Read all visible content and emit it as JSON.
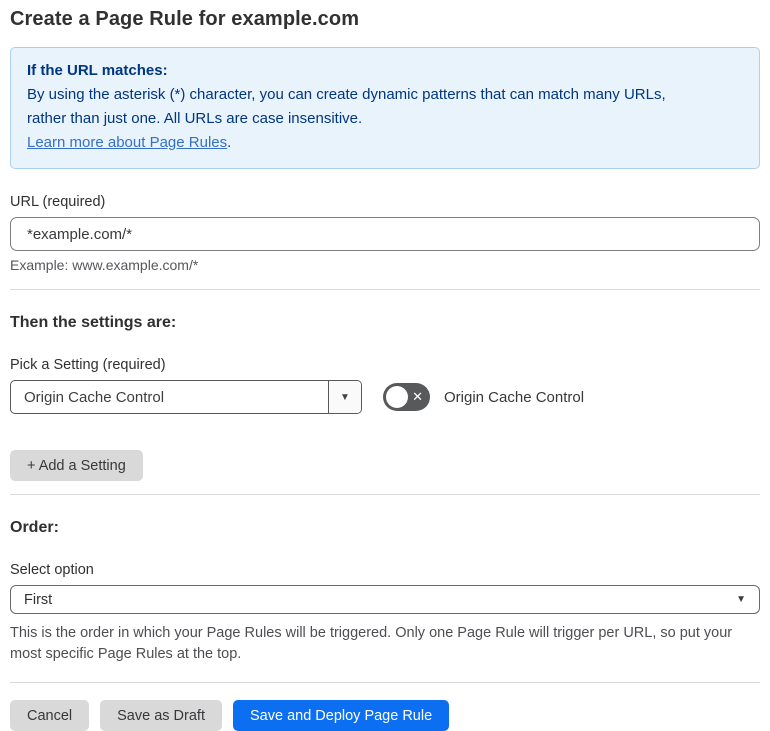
{
  "page": {
    "title": "Create a Page Rule for example.com"
  },
  "info_box": {
    "heading": "If the URL matches:",
    "body_lines": [
      "By using the asterisk (*) character, you can create dynamic patterns that can match many URLs,",
      "rather than just one. All URLs are case insensitive."
    ],
    "link_label": "Learn more about Page Rules",
    "link_suffix": "."
  },
  "url_section": {
    "label": "URL (required)",
    "value": "*example.com/*",
    "example": "Example: www.example.com/*"
  },
  "settings_section": {
    "heading": "Then the settings are:",
    "picker_label": "Pick a Setting (required)",
    "picker_value": "Origin Cache Control",
    "toggle_state": "off",
    "toggle_label": "Origin Cache Control",
    "add_button_label": "+ Add a Setting"
  },
  "order_section": {
    "heading": "Order:",
    "label": "Select option",
    "value": "First",
    "help": "This is the order in which your Page Rules will be triggered. Only one Page Rule will trigger per URL, so put your most specific Page Rules at the top."
  },
  "footer": {
    "cancel_label": "Cancel",
    "save_draft_label": "Save as Draft",
    "save_deploy_label": "Save and Deploy Page Rule"
  },
  "icons": {
    "dropdown_arrow": "▼",
    "toggle_x": "✕"
  },
  "colors": {
    "accent_blue": "#0c6ff2",
    "info_bg": "#e9f3fc",
    "info_border": "#abd0f1",
    "info_text": "#003681",
    "link_blue": "#3570c8",
    "toggle_off_bg": "#58595b",
    "button_gray": "#d9d9d9"
  }
}
